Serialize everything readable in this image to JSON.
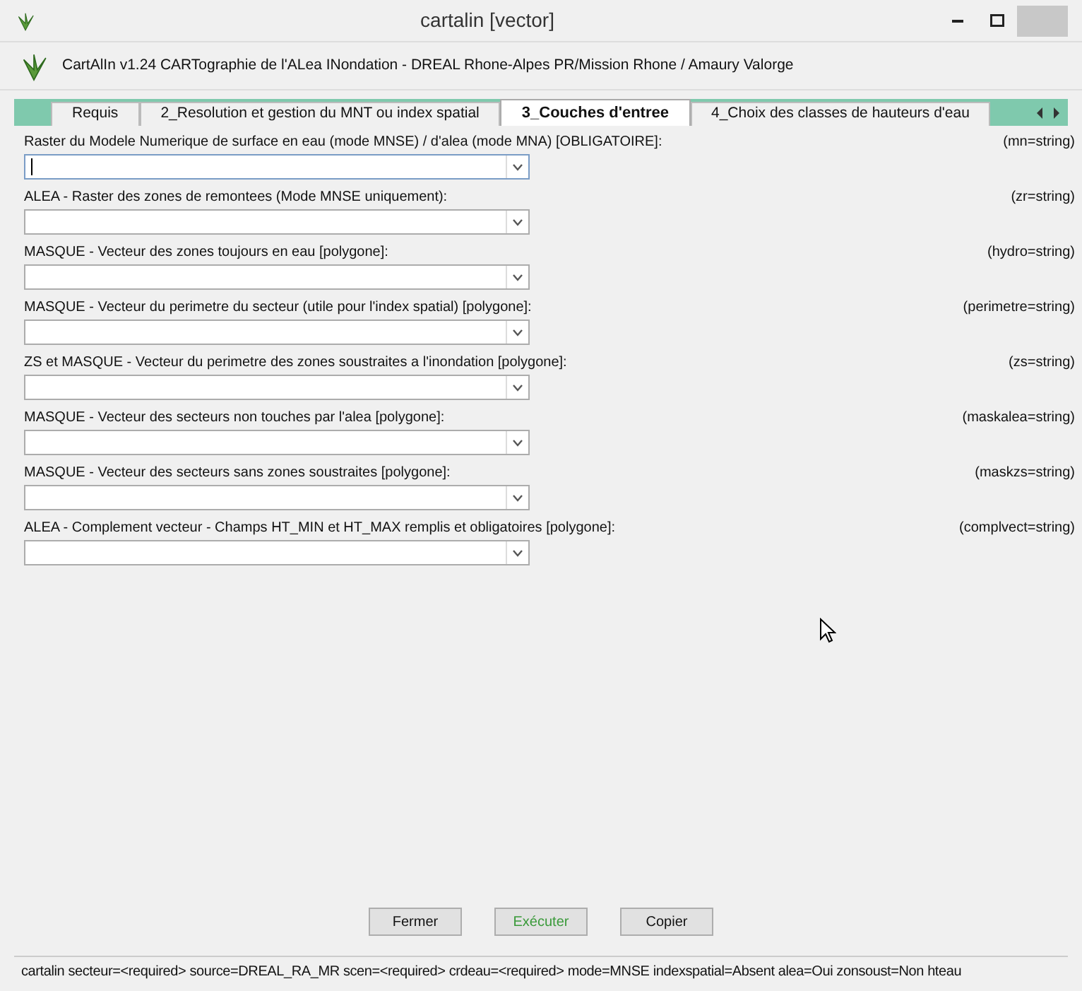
{
  "window": {
    "title": "cartalin [vector]"
  },
  "header": {
    "text": "CartAlIn v1.24 CARTographie de l'ALea INondation - DREAL Rhone-Alpes PR/Mission Rhone / Amaury Valorge"
  },
  "tabs": [
    {
      "label": "Requis",
      "selected": false
    },
    {
      "label": "2_Resolution et gestion du MNT ou index spatial",
      "selected": false
    },
    {
      "label": "3_Couches d'entree",
      "selected": true
    },
    {
      "label": "4_Choix des classes de hauteurs d'eau",
      "selected": false
    }
  ],
  "fields": [
    {
      "label": "Raster du Modele Numerique de surface en eau (mode MNSE) / d'alea  (mode MNA) [OBLIGATOIRE]:",
      "param": "(mn=string)",
      "focused": true
    },
    {
      "label": "ALEA - Raster des zones de remontees (Mode MNSE uniquement):",
      "param": "(zr=string)",
      "focused": false
    },
    {
      "label": "MASQUE - Vecteur des zones toujours en eau [polygone]:",
      "param": "(hydro=string)",
      "focused": false
    },
    {
      "label": "MASQUE - Vecteur du perimetre du secteur (utile pour l'index spatial)  [polygone]:",
      "param": "(perimetre=string)",
      "focused": false
    },
    {
      "label": "ZS et MASQUE - Vecteur du perimetre des zones soustraites a  l'inondation [polygone]:",
      "param": "(zs=string)",
      "focused": false
    },
    {
      "label": "MASQUE - Vecteur des secteurs non touches par l'alea [polygone]:",
      "param": "(maskalea=string)",
      "focused": false
    },
    {
      "label": "MASQUE - Vecteur des secteurs sans zones soustraites [polygone]:",
      "param": "(maskzs=string)",
      "focused": false
    },
    {
      "label": "ALEA - Complement vecteur - Champs HT_MIN et HT_MAX remplis et  obligatoires [polygone]:",
      "param": "(complvect=string)",
      "focused": false
    }
  ],
  "buttons": [
    {
      "label": "Fermer",
      "kind": "normal"
    },
    {
      "label": "Exécuter",
      "kind": "run"
    },
    {
      "label": "Copier",
      "kind": "normal"
    }
  ],
  "status_bar": "cartalin secteur=<required> source=DREAL_RA_MR scen=<required> crdeau=<required> mode=MNSE indexspatial=Absent alea=Oui zonsoust=Non hteau"
}
